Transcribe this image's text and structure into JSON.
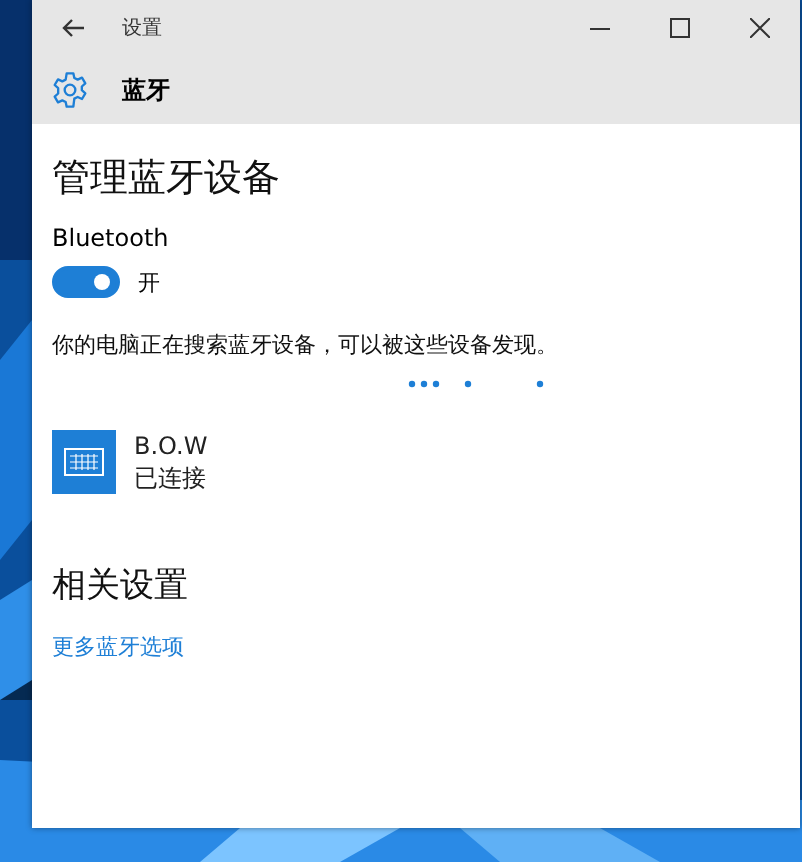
{
  "window": {
    "title": "设置"
  },
  "header": {
    "title": "蓝牙"
  },
  "heading": "管理蓝牙设备",
  "bluetooth": {
    "label": "Bluetooth",
    "on": true,
    "state_text": "开"
  },
  "status_text": "你的电脑正在搜索蓝牙设备，可以被这些设备发现。",
  "devices": [
    {
      "name": "B.O.W",
      "status": "已连接"
    }
  ],
  "related": {
    "heading": "相关设置",
    "links": [
      "更多蓝牙选项"
    ]
  }
}
